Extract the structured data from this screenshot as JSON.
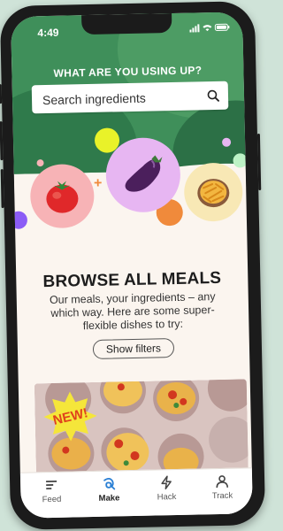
{
  "status_bar": {
    "time": "4:49",
    "icons": "signal wifi battery"
  },
  "header": {
    "question": "WHAT ARE YOU USING UP?"
  },
  "search": {
    "placeholder": "Search ingredients"
  },
  "ingredients": [
    {
      "name": "tomato",
      "bg": "#f7b3b6"
    },
    {
      "name": "eggplant",
      "bg": "#e7b6f2"
    },
    {
      "name": "pasta",
      "bg": "#f8e8b5"
    }
  ],
  "browse": {
    "title": "BROWSE ALL MEALS",
    "description": "Our meals, your ingredients – any which way. Here are some super-flexible dishes to try:",
    "filters_label": "Show filters"
  },
  "meal_card": {
    "badge": "NEW!"
  },
  "tabs": [
    {
      "label": "Feed",
      "icon": "feed-icon"
    },
    {
      "label": "Make",
      "icon": "make-icon",
      "active": true
    },
    {
      "label": "Hack",
      "icon": "hack-icon"
    },
    {
      "label": "Track",
      "icon": "track-icon"
    }
  ],
  "colors": {
    "header_green": "#3f8f5a",
    "page_bg": "#fbf5ef",
    "active_tab": "#1d1d1d",
    "accent_orange": "#f08a3b",
    "accent_purple": "#8b5cf6",
    "accent_yellow": "#e9f229"
  }
}
